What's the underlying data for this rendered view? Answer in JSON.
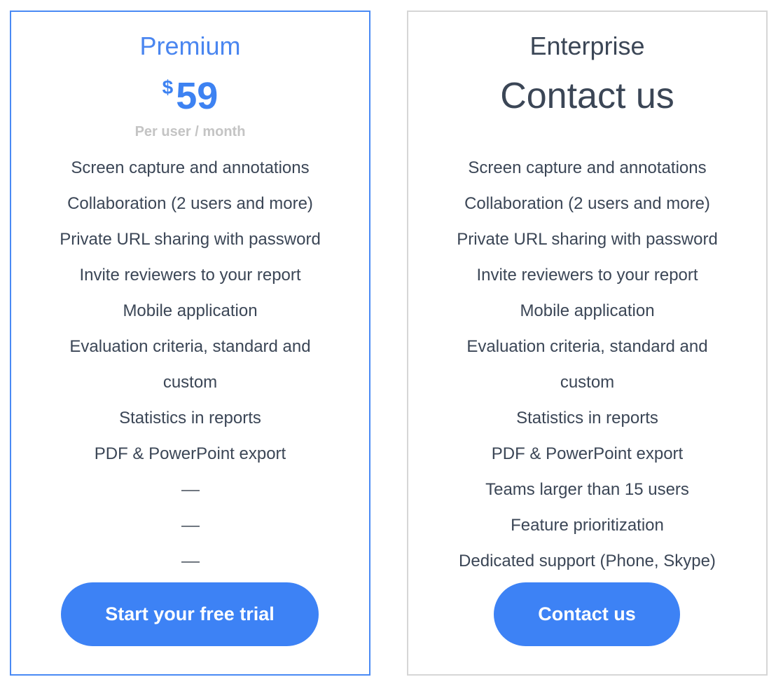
{
  "colors": {
    "accent": "#3d82f5",
    "premium_border": "#4a8af4",
    "enterprise_border": "#d6d6d6",
    "text": "#3b4656",
    "muted": "#c4c4c4"
  },
  "plans": [
    {
      "name": "Premium",
      "price": {
        "currency": "$",
        "amount": "59",
        "period": "Per user / month"
      },
      "features": [
        "Screen capture and annotations",
        "Collaboration (2 users and more)",
        "Private URL sharing with password",
        "Invite reviewers to your report",
        "Mobile application",
        "Evaluation criteria, standard and custom",
        "Statistics in reports",
        "PDF & PowerPoint export",
        "—",
        "—",
        "—"
      ],
      "cta_label": "Start your free trial"
    },
    {
      "name": "Enterprise",
      "price_heading": "Contact us",
      "features": [
        "Screen capture and annotations",
        "Collaboration (2 users and more)",
        "Private URL sharing with password",
        "Invite reviewers to your report",
        "Mobile application",
        "Evaluation criteria, standard and custom",
        "Statistics in reports",
        "PDF & PowerPoint export",
        "Teams larger than 15 users",
        "Feature prioritization",
        "Dedicated support (Phone, Skype)"
      ],
      "cta_label": "Contact us"
    }
  ]
}
